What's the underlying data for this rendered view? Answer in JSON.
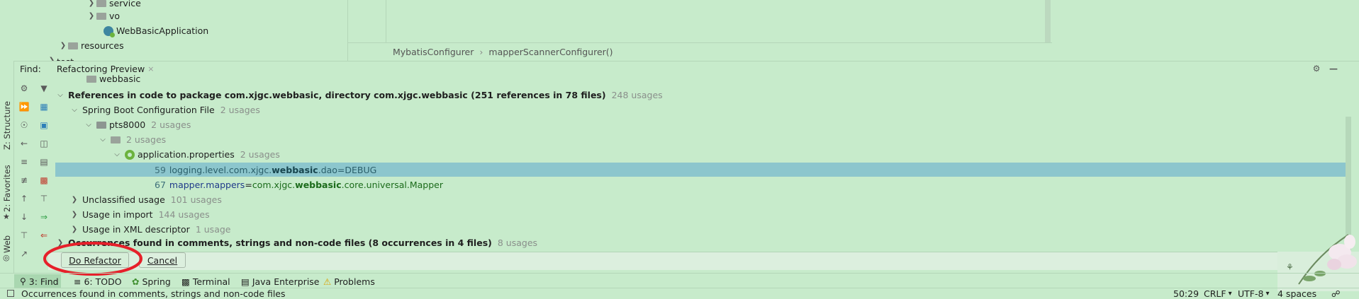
{
  "project_tree": {
    "items": [
      {
        "label": "service",
        "icon": "folder-icon"
      },
      {
        "label": "vo",
        "icon": "folder-icon"
      },
      {
        "label": "WebBasicApplication",
        "icon": "spring-boot-class-icon"
      },
      {
        "label": "resources",
        "icon": "folder-icon"
      },
      {
        "label": "test",
        "icon": "folder-icon"
      }
    ]
  },
  "editor": {
    "breadcrumb": [
      "MybatisConfigurer",
      "mapperScannerConfigurer()"
    ],
    "breadcrumb_separator": "›"
  },
  "find_panel": {
    "title": "Find:",
    "tab_label": "Refactoring Preview",
    "tab_close": "×",
    "clipped_item": "webbasic",
    "tree": {
      "root_label": "References in code to package com.xjgc.webbasic, directory com.xjgc.webbasic (251 references in 78 files)",
      "root_usages": "248 usages",
      "spring_config_label": "Spring Boot Configuration File",
      "spring_config_usages": "2 usages",
      "module_label": "pts8000",
      "module_usages": "2 usages",
      "dir_usages": "2 usages",
      "file_label": "application.properties",
      "file_usages": "2 usages",
      "line1": {
        "num": "59",
        "pre": "logging.level.com.xjgc.",
        "match": "webbasic",
        "post": ".dao=DEBUG"
      },
      "line2": {
        "num": "67",
        "key": "mapper.mappers",
        "eq": "=",
        "pre": "com.xjgc.",
        "match": "webbasic",
        "post": ".core.universal.Mapper"
      },
      "unclassified_label": "Unclassified usage",
      "unclassified_usages": "101 usages",
      "import_label": "Usage in import",
      "import_usages": "144 usages",
      "xml_label": "Usage in XML descriptor",
      "xml_usages": "1 usage",
      "comments_label": "Occurrences found in comments, strings and non-code files  (8 occurrences in 4 files)",
      "comments_usages": "8 usages"
    },
    "do_refactor_label": "Do Refactor",
    "cancel_label": "Cancel"
  },
  "side_tabs": {
    "structure": "Z: Structure",
    "favorites": "2: Favorites",
    "web": "Web"
  },
  "bottom_tabs": [
    {
      "label": "3: Find",
      "icon": "search-icon"
    },
    {
      "label": "6: TODO",
      "icon": "list-icon"
    },
    {
      "label": "Spring",
      "icon": "spring-icon"
    },
    {
      "label": "Terminal",
      "icon": "terminal-icon"
    },
    {
      "label": "Java Enterprise",
      "icon": "java-enterprise-icon"
    },
    {
      "label": "Problems",
      "icon": "warning-icon"
    }
  ],
  "status_bar": {
    "message": "Occurrences found in comments, strings and non-code files",
    "position": "50:29",
    "line_sep": "CRLF",
    "encoding": "UTF-8",
    "indent": "4 spaces"
  },
  "colors": {
    "background": "#c7ebcb",
    "highlight_row": "#8cc6cd",
    "match_text": "#1b6b1b",
    "annotation_circle": "#e6202a"
  }
}
